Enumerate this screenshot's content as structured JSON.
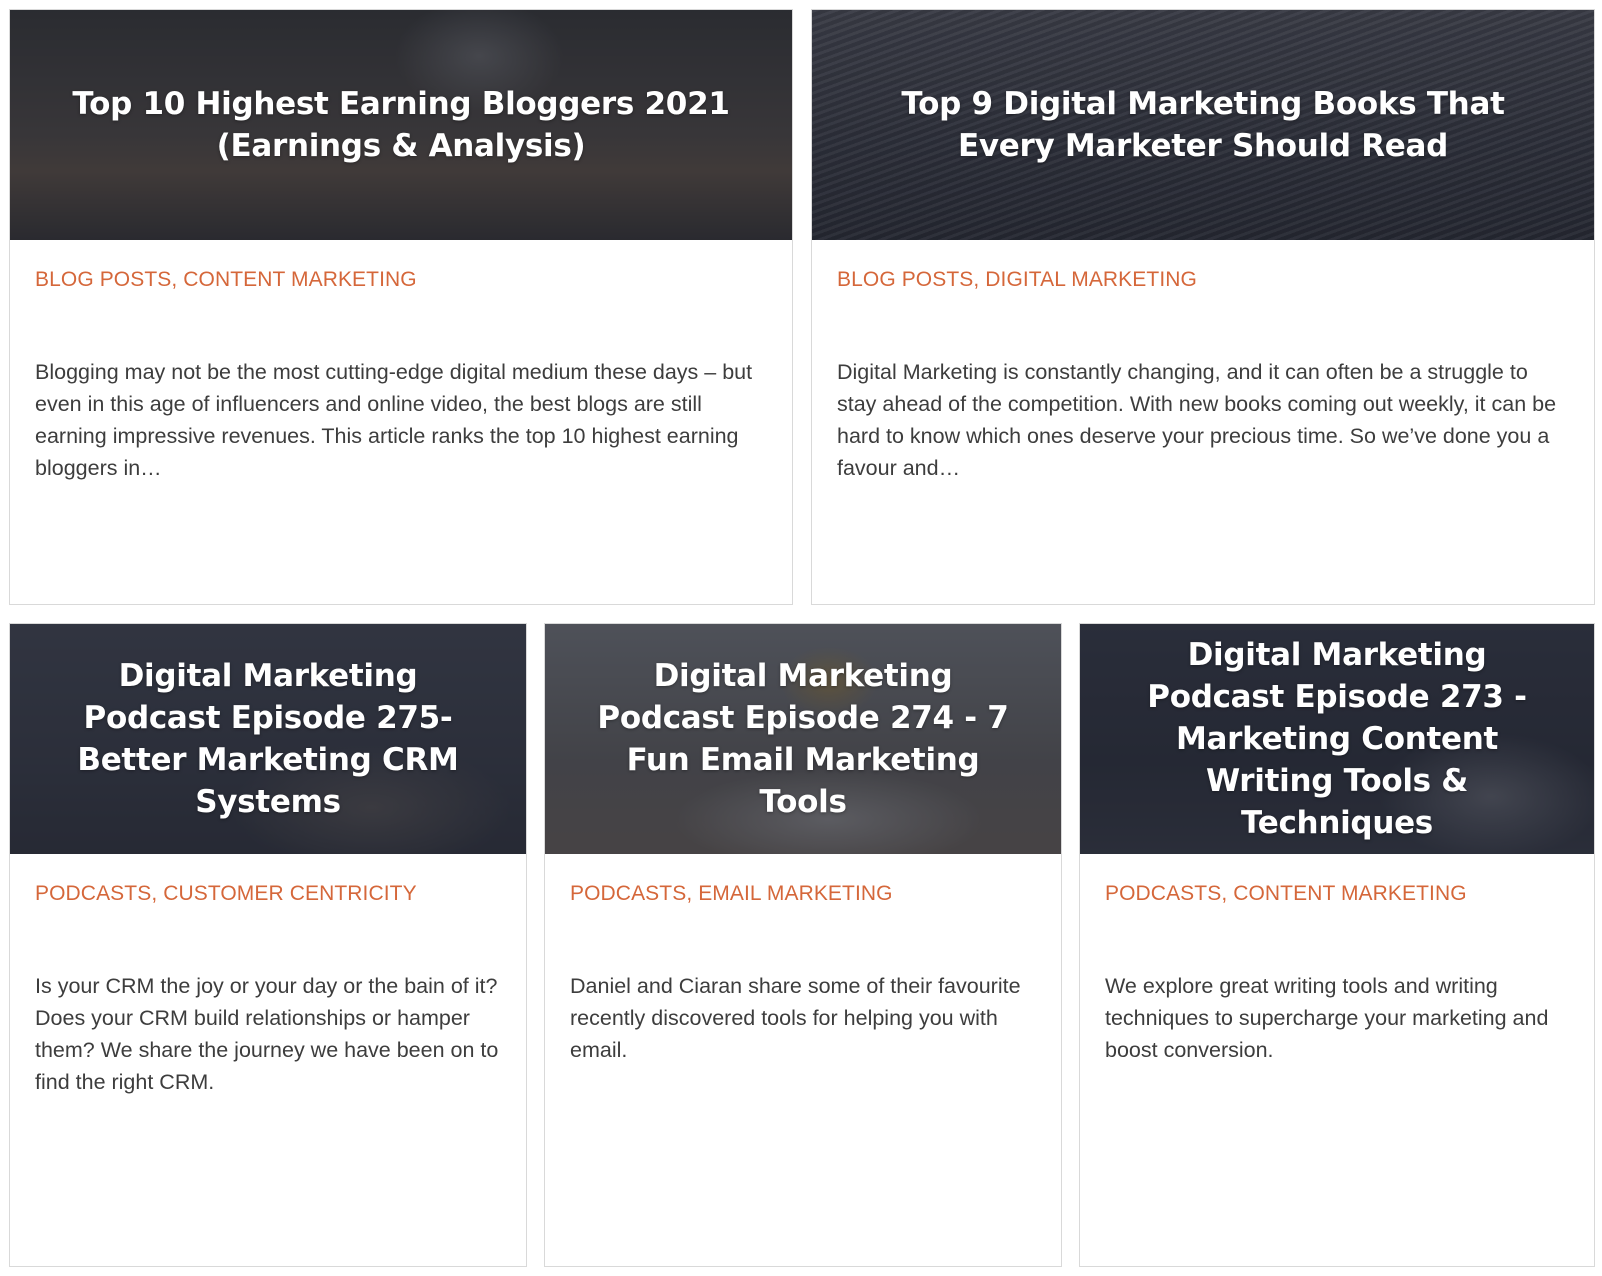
{
  "posts": [
    {
      "title": "Top 10 Highest Earning Bloggers 2021 (Earnings & Analysis)",
      "categories": [
        "BLOG POSTS",
        "CONTENT MARKETING"
      ],
      "categories_text": "BLOG POSTS, CONTENT MARKETING",
      "excerpt": "Blogging may not be the most cutting-edge digital medium these days – but even in this age of influencers and online video, the best blogs are still earning impressive revenues. This article ranks the top 10 highest earning bloggers in…"
    },
    {
      "title": "Top 9 Digital Marketing Books That Every Marketer Should Read",
      "categories": [
        "BLOG POSTS",
        "DIGITAL MARKETING"
      ],
      "categories_text": "BLOG POSTS, DIGITAL MARKETING",
      "excerpt": "Digital Marketing is constantly changing, and it can often be a struggle to stay ahead of the competition. With new books coming out weekly, it can be hard to know which ones deserve your precious time. So we’ve done you a favour and…"
    },
    {
      "title": "Digital Marketing Podcast Episode 275- Better Marketing CRM Systems",
      "categories": [
        "PODCASTS",
        "CUSTOMER CENTRICITY"
      ],
      "categories_text": "PODCASTS, CUSTOMER CENTRICITY",
      "excerpt": "Is your CRM the joy or your day or the bain of it? Does your CRM build relationships or hamper them? We share the journey we have been on to find the right CRM."
    },
    {
      "title": "Digital Marketing Podcast Episode 274 - 7 Fun Email Marketing Tools",
      "categories": [
        "PODCASTS",
        "EMAIL MARKETING"
      ],
      "categories_text": "PODCASTS, EMAIL MARKETING",
      "excerpt": "Daniel and Ciaran share some of their favourite recently discovered tools for helping you with email."
    },
    {
      "title": "Digital Marketing Podcast Episode 273 - Marketing Content Writing Tools & Techniques",
      "categories": [
        "PODCASTS",
        "CONTENT MARKETING"
      ],
      "categories_text": "PODCASTS, CONTENT MARKETING",
      "excerpt": "We explore great writing tools and writing techniques to supercharge your marketing and boost conversion."
    }
  ],
  "theme": {
    "category_color": "#d5673a",
    "text_color": "#3d3d3d",
    "title_color": "#ffffff",
    "border_color": "#d9d9d9"
  }
}
